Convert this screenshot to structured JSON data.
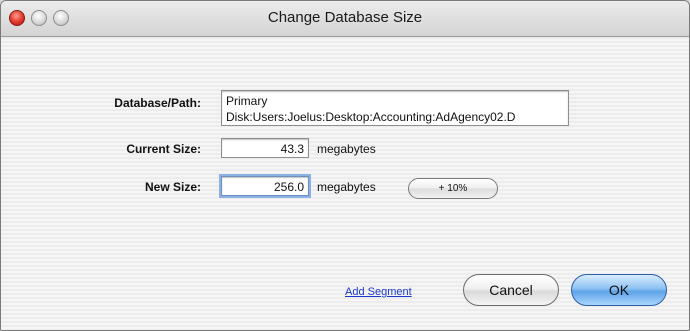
{
  "window": {
    "title": "Change Database Size"
  },
  "form": {
    "path_label": "Database/Path:",
    "path_value_line1": "Primary",
    "path_value_line2": "Disk:Users:Joelus:Desktop:Accounting:AdAgency02.D",
    "current_label": "Current Size:",
    "current_value": "43.3",
    "current_unit": "megabytes",
    "new_label": "New Size:",
    "new_value": "256.0",
    "new_unit": "megabytes",
    "increment_label": "+ 10%"
  },
  "footer": {
    "add_segment": "Add Segment",
    "cancel": "Cancel",
    "ok": "OK"
  }
}
